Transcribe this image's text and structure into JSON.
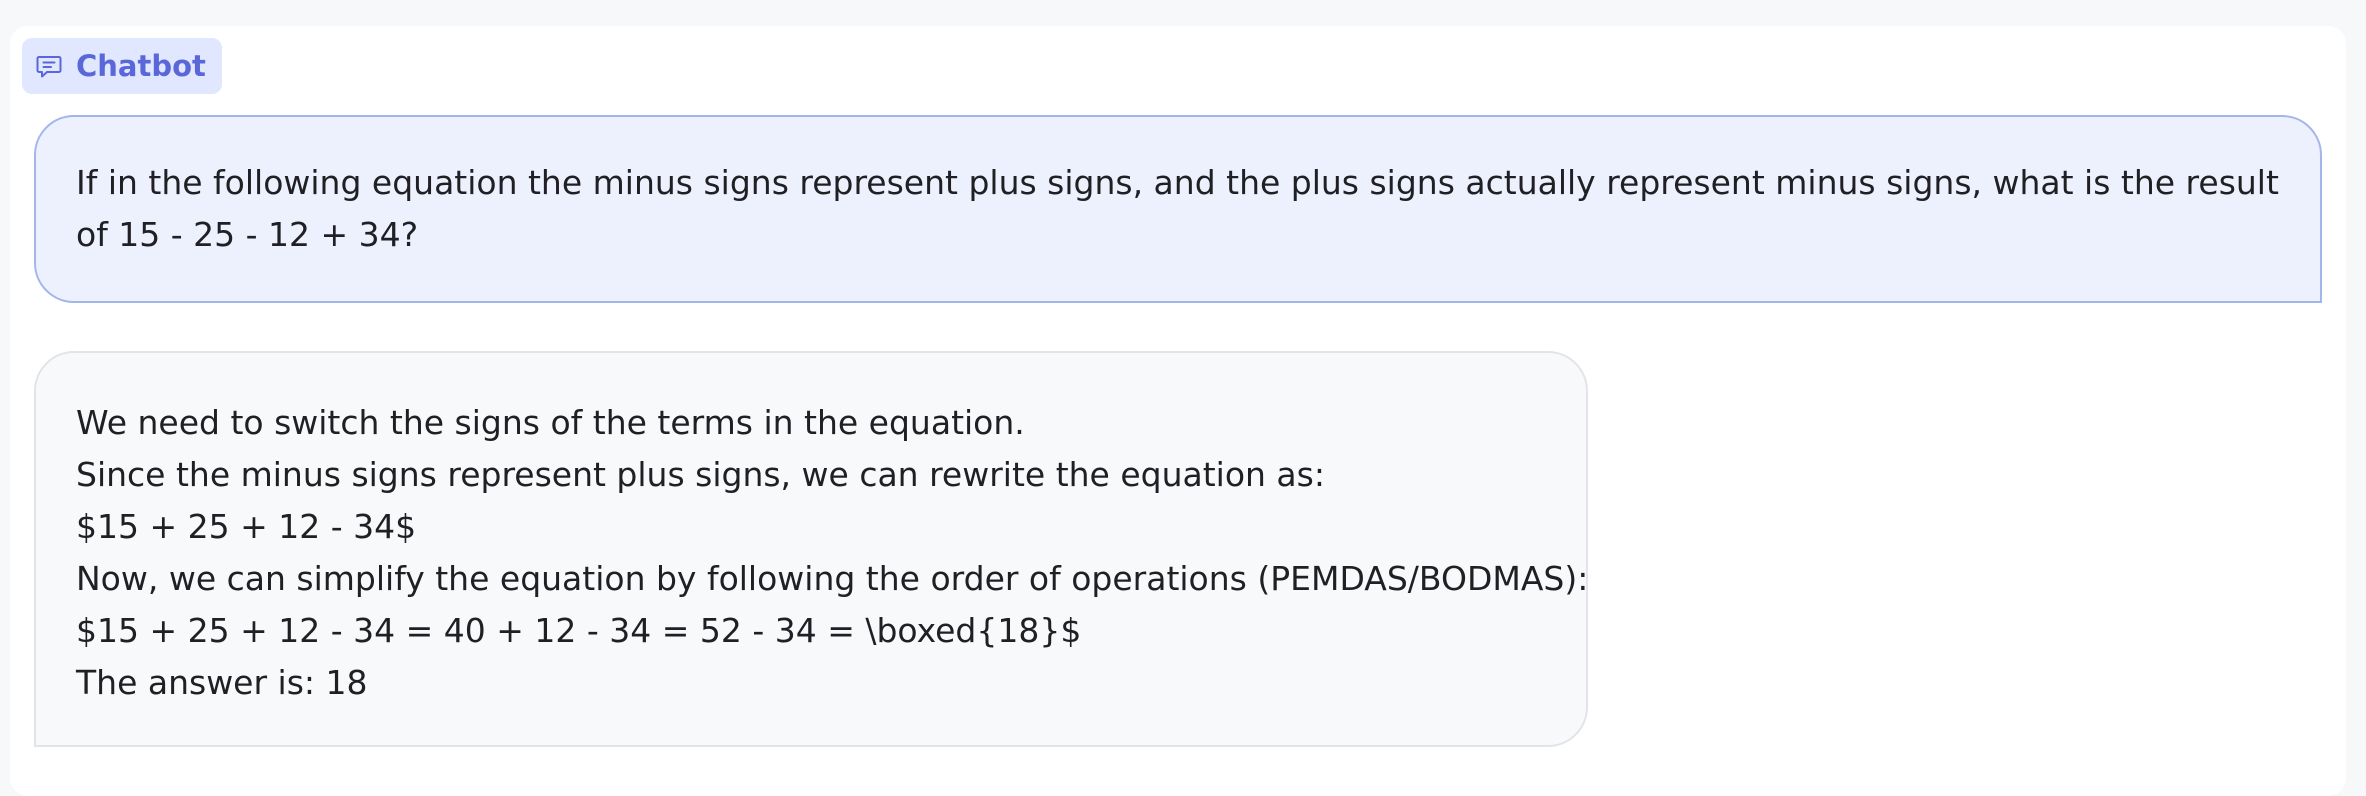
{
  "header": {
    "label": "Chatbot",
    "icon": "chat-icon",
    "accent_color": "#5a67d8"
  },
  "messages": {
    "user": {
      "text": "If in the following equation the minus signs represent plus signs, and the plus signs actually represent minus signs, what is the result of 15 - 25 - 12 + 34?"
    },
    "bot": {
      "lines": [
        "We need to switch the signs of the terms in the equation.",
        "Since the minus signs represent plus signs, we can rewrite the equation as:",
        "$15 + 25 + 12 - 34$",
        "Now, we can simplify the equation by following the order of operations (PEMDAS/BODMAS):",
        "$15 + 25 + 12 - 34 = 40 + 12 - 34 = 52 - 34 = \\boxed{18}$",
        "The answer is: 18"
      ]
    }
  }
}
